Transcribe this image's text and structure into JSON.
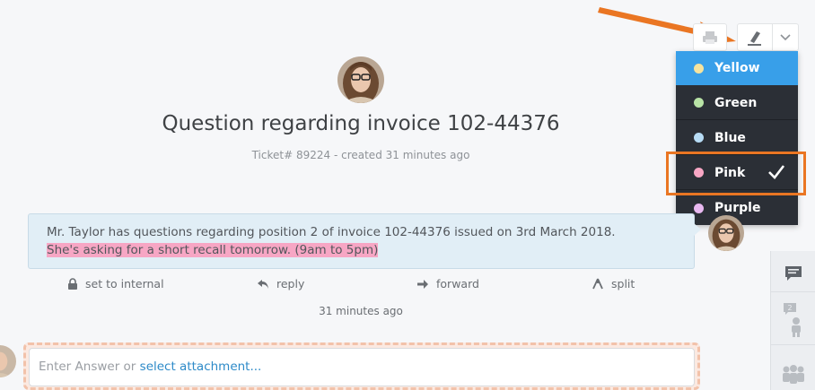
{
  "ticket": {
    "title": "Question regarding invoice 102-44376",
    "meta": "Ticket# 89224 - created 31 minutes ago"
  },
  "article": {
    "line1": "Mr. Taylor has questions regarding position 2 of invoice 102-44376 issued on 3rd March 2018.",
    "line2": "She's asking for a short recall tomorrow. (9am to 5pm)",
    "highlight_color": "#f7a6c4",
    "actions": {
      "set_internal": "set to internal",
      "reply": "reply",
      "forward": "forward",
      "split": "split"
    },
    "time": "31 minutes ago"
  },
  "reply": {
    "placeholder_prefix": "Enter Answer or",
    "attachment_link": "select attachment..."
  },
  "highlight_menu": {
    "items": [
      {
        "label": "Yellow",
        "color": "#f5e39e",
        "active": true
      },
      {
        "label": "Green",
        "color": "#b8e3a6",
        "active": false
      },
      {
        "label": "Blue",
        "color": "#b7dcf5",
        "active": false
      },
      {
        "label": "Pink",
        "color": "#f7a6c4",
        "active": false,
        "checked": true
      },
      {
        "label": "Purple",
        "color": "#e8b8f0",
        "active": false
      }
    ]
  },
  "colors": {
    "accent": "#389fe9",
    "annotation": "#ea7623",
    "link": "#2d8ac8"
  },
  "sidebar": {
    "icons": [
      "chat-icon",
      "customer-icon",
      "organization-icon"
    ],
    "badge": "2"
  }
}
